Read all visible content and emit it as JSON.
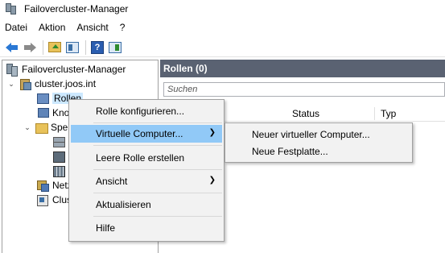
{
  "window": {
    "title": "Failovercluster-Manager"
  },
  "menubar": {
    "items": [
      "Datei",
      "Aktion",
      "Ansicht",
      "?"
    ]
  },
  "toolbar": {
    "buttons": [
      {
        "name": "back",
        "icon": "back-arrow-icon"
      },
      {
        "name": "forward",
        "icon": "forward-arrow-icon"
      },
      {
        "name": "up",
        "icon": "folder-up-icon"
      },
      {
        "name": "show-hide-console-tree",
        "icon": "console-tree-icon"
      },
      {
        "name": "help",
        "icon": "help-icon",
        "label": "?"
      },
      {
        "name": "show-hide-action-pane",
        "icon": "action-pane-icon"
      }
    ]
  },
  "tree": {
    "root": "Failovercluster-Manager",
    "cluster": "cluster.joos.int",
    "roles": "Rollen",
    "nodes": "Knoten",
    "storage": "Speicher",
    "networks": "Netzwerke",
    "events": "Clusterereignisse"
  },
  "right_pane": {
    "header": "Rollen (0)",
    "search_placeholder": "Suchen",
    "columns": [
      "Status",
      "Typ"
    ]
  },
  "context_menu": {
    "items": [
      {
        "label": "Rolle konfigurieren...",
        "submenu": false
      },
      {
        "label": "Virtuelle Computer...",
        "submenu": true,
        "highlighted": true
      },
      {
        "label": "Leere Rolle erstellen",
        "submenu": false
      },
      {
        "label": "Ansicht",
        "submenu": true
      },
      {
        "label": "Aktualisieren",
        "submenu": false
      },
      {
        "label": "Hilfe",
        "submenu": false
      }
    ],
    "submenu_items": [
      "Neuer virtueller Computer...",
      "Neue Festplatte..."
    ],
    "highlight_color": "#91c9f7"
  },
  "colors": {
    "pane_header": "#5a6272",
    "selection": "#cce8ff"
  }
}
